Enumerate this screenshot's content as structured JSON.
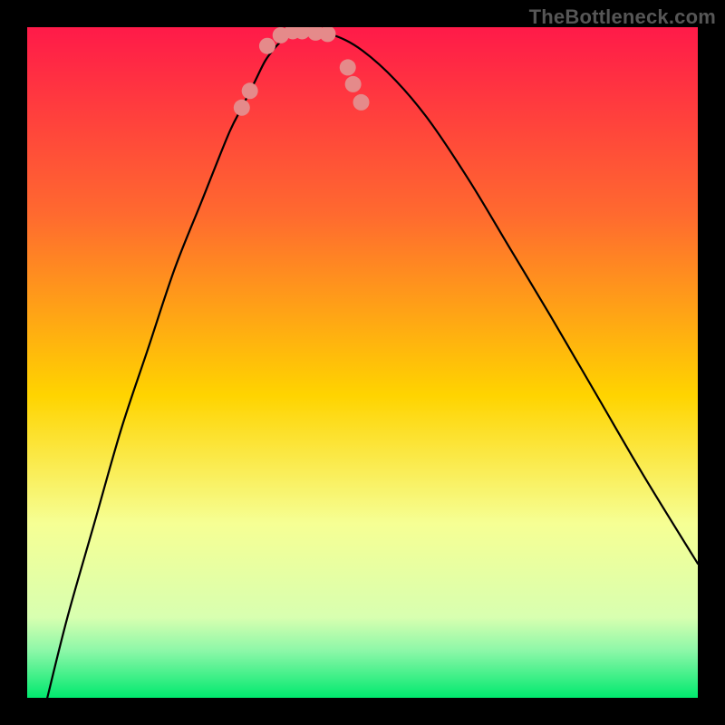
{
  "watermark": "TheBottleneck.com",
  "chart_data": {
    "type": "line",
    "title": "",
    "xlabel": "",
    "ylabel": "",
    "xlim": [
      0,
      100
    ],
    "ylim": [
      0,
      100
    ],
    "grid": false,
    "legend": false,
    "background": {
      "top_color": "#ff1a49",
      "mid_color": "#ffd400",
      "green_band_top_color": "#f6ff94",
      "green_band_bottom_color": "#00e96e",
      "green_band_start_y": 74,
      "green_band_end_y": 100
    },
    "series": [
      {
        "name": "curve",
        "x": [
          3,
          6,
          10,
          14,
          18,
          22,
          26,
          30,
          32,
          34,
          35.5,
          37,
          38.5,
          40,
          42,
          46,
          50,
          55,
          60,
          66,
          72,
          78,
          85,
          92,
          100
        ],
        "y": [
          0,
          12,
          26,
          40,
          52,
          64,
          74,
          84,
          88,
          92,
          95,
          97,
          98.5,
          99.4,
          99.4,
          98.7,
          96.5,
          92,
          86,
          77,
          67,
          57,
          45,
          33,
          20
        ],
        "color": "#000000",
        "linewidth": 2.2
      }
    ],
    "markers": {
      "name": "dots",
      "color": "#e58a8a",
      "radius": 9,
      "points": [
        {
          "x": 32.0,
          "y": 88.0
        },
        {
          "x": 33.2,
          "y": 90.5
        },
        {
          "x": 35.8,
          "y": 97.2
        },
        {
          "x": 37.8,
          "y": 98.8
        },
        {
          "x": 39.6,
          "y": 99.4
        },
        {
          "x": 41.0,
          "y": 99.4
        },
        {
          "x": 43.0,
          "y": 99.2
        },
        {
          "x": 44.8,
          "y": 99.0
        },
        {
          "x": 47.8,
          "y": 94.0
        },
        {
          "x": 48.6,
          "y": 91.5
        },
        {
          "x": 49.8,
          "y": 88.8
        }
      ]
    }
  }
}
